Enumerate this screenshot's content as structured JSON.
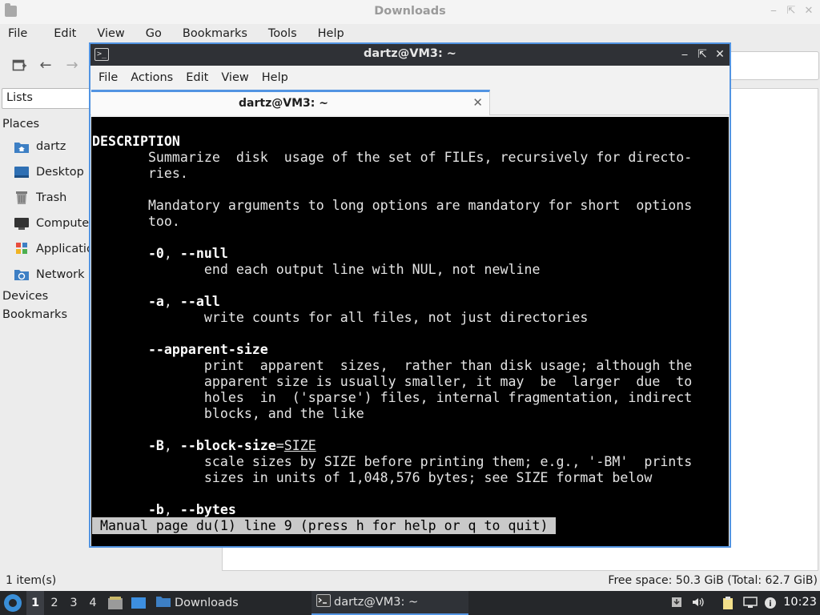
{
  "file_manager": {
    "title": "Downloads",
    "menu": [
      "File",
      "Edit",
      "View",
      "Go",
      "Bookmarks",
      "Tools",
      "Help"
    ],
    "side_combo": "Lists",
    "sections": {
      "places": "Places",
      "devices": "Devices",
      "bookmarks": "Bookmarks"
    },
    "places": [
      {
        "label": "dartz",
        "icon": "home-folder-icon"
      },
      {
        "label": "Desktop",
        "icon": "desktop-icon"
      },
      {
        "label": "Trash",
        "icon": "trash-icon"
      },
      {
        "label": "Computer",
        "icon": "computer-icon"
      },
      {
        "label": "Applications",
        "icon": "applications-icon"
      },
      {
        "label": "Network",
        "icon": "network-icon"
      }
    ],
    "status_left": "1 item(s)",
    "status_right": "Free space: 50.3 GiB (Total: 62.7 GiB)"
  },
  "terminal": {
    "title": "dartz@VM3: ~",
    "menu": [
      "File",
      "Actions",
      "Edit",
      "View",
      "Help"
    ],
    "tab_label": "dartz@VM3: ~",
    "man": {
      "heading": "DESCRIPTION",
      "desc_1": "Summarize  disk  usage of the set of FILEs, recursively for directo-",
      "desc_2": "ries.",
      "mand_1": "Mandatory arguments to long options are mandatory for short  options",
      "mand_2": "too.",
      "opt_null": "-0",
      "opt_null_long": "--null",
      "opt_null_desc": "end each output line with NUL, not newline",
      "opt_all": "-a",
      "opt_all_long": "--all",
      "opt_all_desc": "write counts for all files, not just directories",
      "opt_apparent": "--apparent-size",
      "apparent_1": "print  apparent  sizes,  rather than disk usage; although the",
      "apparent_2": "apparent size is usually smaller, it may  be  larger  due  to",
      "apparent_3": "holes  in  ('sparse') files, internal fragmentation, indirect",
      "apparent_4": "blocks, and the like",
      "opt_block": "-B",
      "opt_block_long": "--block-size",
      "opt_block_arg": "SIZE",
      "block_1": "scale sizes by SIZE before printing them; e.g., '-BM'  prints",
      "block_2": "sizes in units of 1,048,576 bytes; see SIZE format below",
      "opt_bytes": "-b",
      "opt_bytes_long": "--bytes"
    },
    "status_line": "Manual page du(1) line 9 (press h for help or q to quit)"
  },
  "taskbar": {
    "workspaces": [
      "1",
      "2",
      "3",
      "4"
    ],
    "active_workspace": "1",
    "tasks": [
      {
        "label": "Downloads",
        "icon": "folder-icon"
      },
      {
        "label": "dartz@VM3: ~",
        "icon": "terminal-icon"
      }
    ],
    "clock": "10:23"
  }
}
